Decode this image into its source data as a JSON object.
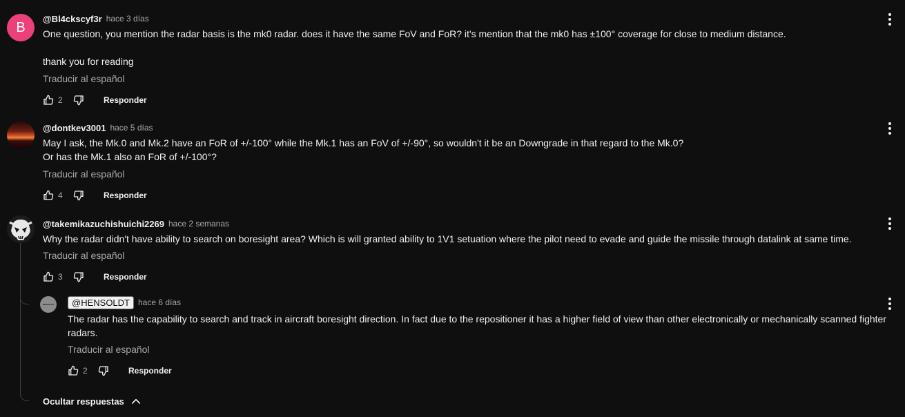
{
  "comments": [
    {
      "author": "@Bl4ckscyf3r",
      "time": "hace 3 días",
      "avatar_letter": "B",
      "text": "One question, you mention the radar basis is the mk0 radar. does it have the same FoV and FoR? it's mention that the mk0 has ±100° coverage for close to medium distance.\n\nthank you for reading",
      "translate": "Traducir al español",
      "likes": "2",
      "reply": "Responder"
    },
    {
      "author": "@dontkev3001",
      "time": "hace 5 días",
      "text": "May I ask, the Mk.0 and Mk.2 have an FoR of +/-100° while the Mk.1 has an FoV of +/-90°, so wouldn't it be an Downgrade in that regard to the Mk.0?\nOr has the Mk.1 also an FoR of +/-100°?",
      "translate": "Traducir al español",
      "likes": "4",
      "reply": "Responder"
    },
    {
      "author": "@takemikazuchishuichi2269",
      "time": "hace 2 semanas",
      "text": "Why the radar didn't have ability to search on boresight area? Which is will granted ability to 1V1 setuation where the pilot need to evade and guide the missile through datalink at same time.",
      "translate": "Traducir al español",
      "likes": "3",
      "reply": "Responder"
    }
  ],
  "reply": {
    "author": "@HENSOLDT",
    "time": "hace 6 días",
    "avatar_text": "HENSOLDT",
    "text": "The radar has the capability to search and track in aircraft boresight direction. In fact due to the repositioner it has a higher field of view than other electronically or mechanically scanned fighter radars.",
    "translate": "Traducir al español",
    "likes": "2",
    "reply": "Responder"
  },
  "hide_replies": "Ocultar respuestas",
  "colors": {
    "background": "#0f0f0f",
    "text_primary": "#f1f1f1",
    "text_secondary": "#aaaaaa",
    "avatar_b": "#ec407a"
  },
  "icons": [
    "thumb-up-icon",
    "thumb-down-icon",
    "more-vert-icon",
    "chevron-up-icon"
  ]
}
